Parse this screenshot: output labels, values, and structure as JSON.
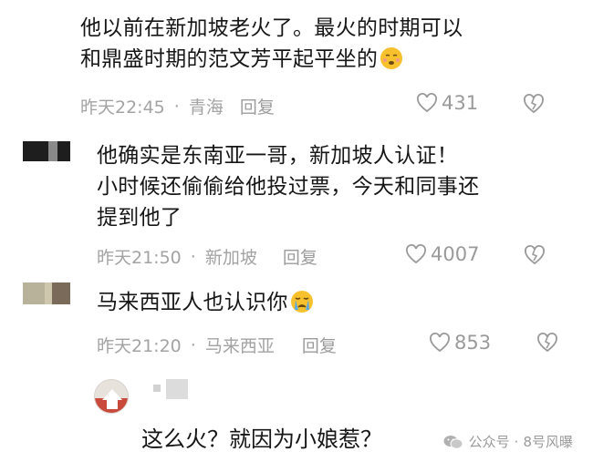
{
  "comments": [
    {
      "lines": [
        "他以前在新加坡老火了。最火的时期可以",
        "和鼎盛时期的范文芳平起平坐的"
      ],
      "time": "昨天22:45",
      "location": "青海",
      "reply": "回复",
      "likes": "431"
    },
    {
      "lines": [
        "他确实是东南亚一哥，新加坡人认证！",
        "小时候还偷偷给他投过票，今天和同事还",
        "提到他了"
      ],
      "time": "昨天21:50",
      "location": "新加坡",
      "reply": "回复",
      "likes": "4007"
    },
    {
      "lines": [
        "马来西亚人也认识你"
      ],
      "time": "昨天21:20",
      "location": "马来西亚",
      "reply": "回复",
      "likes": "853"
    }
  ],
  "separator": "·",
  "caption": "这么火？就因为小娘惹？",
  "watermark": {
    "brand": "公众号",
    "sep": "·",
    "account": "8号风曝"
  },
  "colors": {
    "text": "#161616",
    "meta": "#a3a3a3",
    "emoji_yellow": "#f7c12e"
  }
}
